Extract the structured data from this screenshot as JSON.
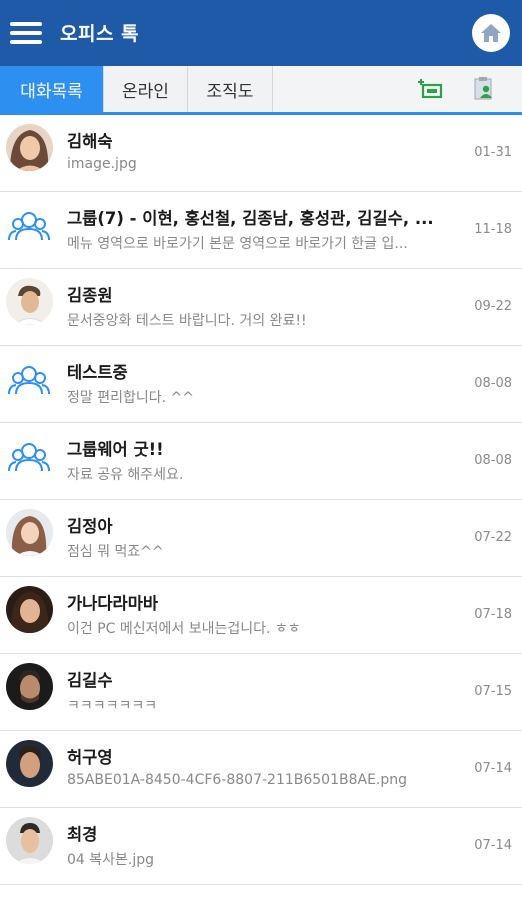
{
  "header": {
    "title": "오피스 톡",
    "menu_icon": "hamburger-menu-icon",
    "home_icon": "home-icon",
    "color": "#1f5aa8"
  },
  "tabs": [
    {
      "label": "대화목록",
      "active": true
    },
    {
      "label": "온라인",
      "active": false
    },
    {
      "label": "조직도",
      "active": false
    }
  ],
  "toolbar": {
    "new_chat_icon": "add-chat-icon",
    "contacts_icon": "contact-list-icon"
  },
  "accent_color": "#2d8ff0",
  "chats": [
    {
      "name": "김해숙",
      "message": "image.jpg",
      "date": "01-31",
      "avatar": "photo"
    },
    {
      "name": "그룹(7) - 이현, 홍선철, 김종남, 홍성관, 김길수, ...",
      "message": "메뉴 영역으로 바로가기 본문 영역으로 바로가기 한글 입...",
      "date": "11-18",
      "avatar": "group"
    },
    {
      "name": "김종원",
      "message": "문서중앙화 테스트 바랍니다. 거의 완료!!",
      "date": "09-22",
      "avatar": "photo"
    },
    {
      "name": "테스트중",
      "message": "정말 편리합니다. ^^",
      "date": "08-08",
      "avatar": "group"
    },
    {
      "name": "그룹웨어 굿!!",
      "message": "자료 공유 해주세요.",
      "date": "08-08",
      "avatar": "group"
    },
    {
      "name": "김정아",
      "message": "점심 뭐 먹죠^^",
      "date": "07-22",
      "avatar": "photo"
    },
    {
      "name": "가나다라마바",
      "message": "이건 PC 메신저에서 보내는겁니다. ㅎㅎ",
      "date": "07-18",
      "avatar": "photo"
    },
    {
      "name": "김길수",
      "message": "ㅋㅋㅋㅋㅋㅋㅋ",
      "date": "07-15",
      "avatar": "photo"
    },
    {
      "name": "허구영",
      "message": "85ABE01A-8450-4CF6-8807-211B6501B8AE.png",
      "date": "07-14",
      "avatar": "photo"
    },
    {
      "name": "최경",
      "message": "04 복사본.jpg",
      "date": "07-14",
      "avatar": "photo"
    }
  ]
}
